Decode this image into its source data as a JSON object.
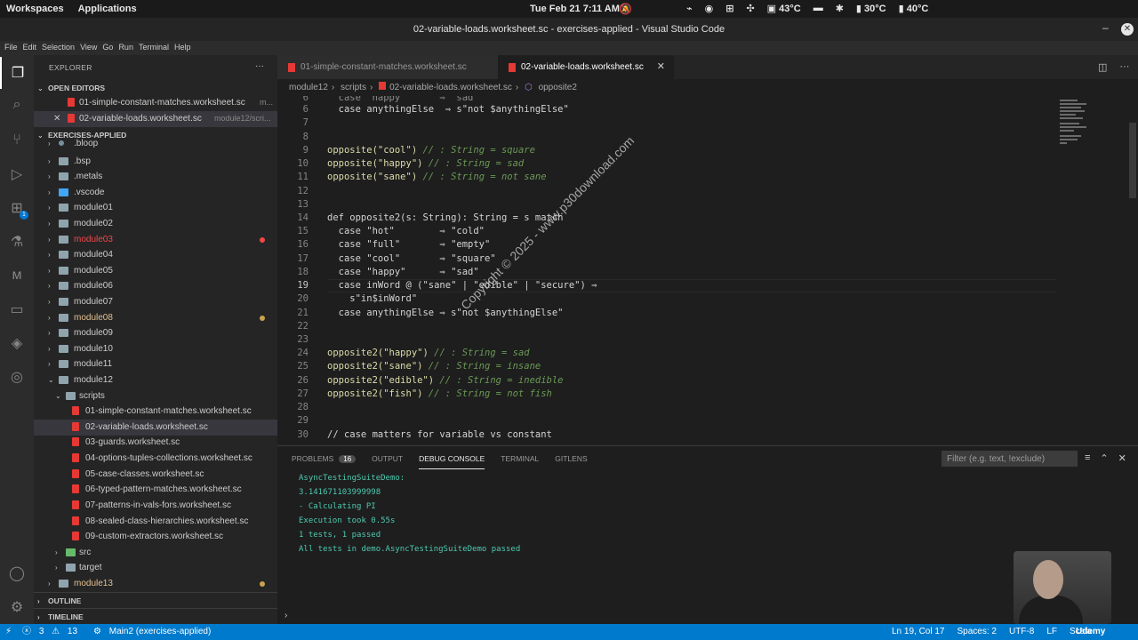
{
  "topbar": {
    "workspaces": "Workspaces",
    "applications": "Applications",
    "clock": "Tue Feb 21  7:11 AM",
    "cpu_temp": "43°C",
    "temp2": "30°C",
    "temp3": "40°C"
  },
  "window": {
    "title": "02-variable-loads.worksheet.sc - exercises-applied - Visual Studio Code"
  },
  "menu": [
    "File",
    "Edit",
    "Selection",
    "View",
    "Go",
    "Run",
    "Terminal",
    "Help"
  ],
  "sidebar": {
    "header": "EXPLORER",
    "open_editors": "OPEN EDITORS",
    "open_files": [
      {
        "name": "01-simple-constant-matches.worksheet.sc",
        "hint": "m..."
      },
      {
        "name": "02-variable-loads.worksheet.sc",
        "hint": "module12/scri..."
      }
    ],
    "workspace": "EXERCISES-APPLIED",
    "tree": [
      ".bloop",
      ".bsp",
      ".metals",
      ".vscode",
      "module01",
      "module02",
      "module03",
      "module04",
      "module05",
      "module06",
      "module07",
      "module08",
      "module09",
      "module10",
      "module11",
      "module12",
      "scripts",
      "01-simple-constant-matches.worksheet.sc",
      "02-variable-loads.worksheet.sc",
      "03-guards.worksheet.sc",
      "04-options-tuples-collections.worksheet.sc",
      "05-case-classes.worksheet.sc",
      "06-typed-pattern-matches.worksheet.sc",
      "07-patterns-in-vals-fors.worksheet.sc",
      "08-sealed-class-hierarchies.worksheet.sc",
      "09-custom-extractors.worksheet.sc",
      "src",
      "target",
      "module13"
    ],
    "outline": "OUTLINE",
    "timeline": "TIMELINE"
  },
  "tabs": [
    {
      "label": "01-simple-constant-matches.worksheet.sc"
    },
    {
      "label": "02-variable-loads.worksheet.sc"
    }
  ],
  "breadcrumbs": [
    "module12",
    "scripts",
    "02-variable-loads.worksheet.sc",
    "opposite2"
  ],
  "code": {
    "line_numbers": [
      "6",
      "7",
      "8",
      "9",
      "10",
      "11",
      "12",
      "13",
      "14",
      "15",
      "16",
      "17",
      "18",
      "19",
      "20",
      "21",
      "22",
      "23",
      "24",
      "25",
      "26",
      "27",
      "28",
      "29",
      "30"
    ],
    "l5": "  case \"happy\"      ⇒ \"sad\"",
    "l6": "  case anythingElse  ⇒ s\"not $anythingElse\"",
    "l9a": "opposite(\"cool\")",
    "l9b": " // : String = square",
    "l10a": "opposite(\"happy\")",
    "l10b": " // : String = sad",
    "l11a": "opposite(\"sane\")",
    "l11b": " // : String = not sane",
    "l14": "def opposite2(s: String): String = s match",
    "l15": "  case \"hot\"        ⇒ \"cold\"",
    "l16": "  case \"full\"       ⇒ \"empty\"",
    "l17": "  case \"cool\"       ⇒ \"square\"",
    "l18": "  case \"happy\"      ⇒ \"sad\"",
    "l19": "  case inWord @ (\"sane\" | \"edible\" | \"secure\") ⇒",
    "l20": "    s\"in$inWord\"",
    "l21": "  case anythingElse ⇒ s\"not $anythingElse\"",
    "l24a": "opposite2(\"happy\")",
    "l24b": " // : String = sad",
    "l25a": "opposite2(\"sane\")",
    "l25b": " // : String = insane",
    "l26a": "opposite2(\"edible\")",
    "l26b": " // : String = inedible",
    "l27a": "opposite2(\"fish\")",
    "l27b": " // : String = not fish",
    "l30": "// case matters for variable vs constant"
  },
  "watermark": "Copyright © 2025 - www.p30download.com",
  "panel": {
    "tabs": [
      "PROBLEMS",
      "OUTPUT",
      "DEBUG CONSOLE",
      "TERMINAL",
      "GITLENS"
    ],
    "problems_count": "16",
    "filter_placeholder": "Filter (e.g. text, !exclude)",
    "output": [
      "AsyncTestingSuiteDemo:",
      "3.141671103999998",
      "- Calculating PI",
      "Execution took 0.55s",
      "1 tests, 1 passed",
      "All tests in demo.AsyncTestingSuiteDemo passed"
    ]
  },
  "status": {
    "errors": "3",
    "warnings": "13",
    "branch": "Main2 (exercises-applied)",
    "position": "Ln 19, Col 17",
    "spaces": "Spaces: 2",
    "encoding": "UTF-8",
    "eol": "LF",
    "language": "Scala",
    "brand": "Udemy"
  }
}
